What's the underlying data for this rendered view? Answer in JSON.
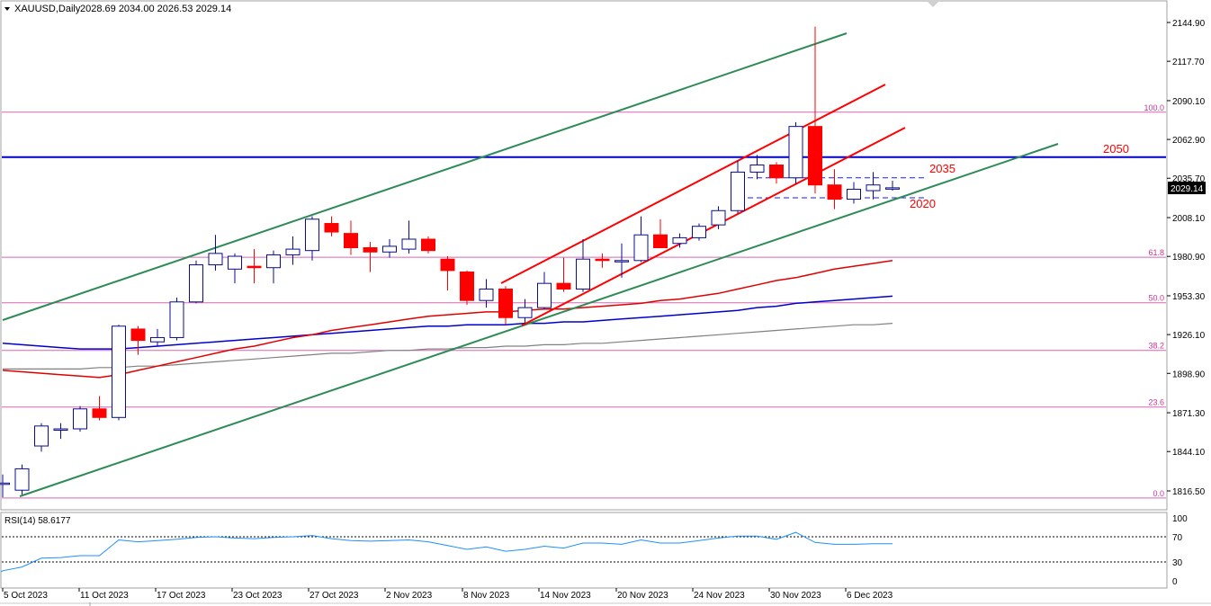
{
  "header": {
    "symbol": "XAUUSD,Daily",
    "ohlc": "2028.69 2034.00 2026.53 2029.14"
  },
  "chart_data": {
    "type": "candlestick",
    "price_axis_ticks": [
      "2144.90",
      "2117.70",
      "2090.10",
      "2062.90",
      "2035.70",
      "2008.10",
      "1980.90",
      "1953.30",
      "1926.10",
      "1898.90",
      "1871.30",
      "1844.10",
      "1816.50"
    ],
    "current_price": "2029.14",
    "x_labels": [
      "5 Oct 2023",
      "11 Oct 2023",
      "17 Oct 2023",
      "23 Oct 2023",
      "27 Oct 2023",
      "2 Nov 2023",
      "8 Nov 2023",
      "14 Nov 2023",
      "20 Nov 2023",
      "24 Nov 2023",
      "30 Nov 2023",
      "6 Dec 2023"
    ],
    "candles": [
      {
        "o": 1822,
        "h": 1828,
        "l": 1812,
        "c": 1822
      },
      {
        "o": 1817,
        "h": 1835,
        "l": 1814,
        "c": 1832
      },
      {
        "o": 1848,
        "h": 1864,
        "l": 1844,
        "c": 1862
      },
      {
        "o": 1860,
        "h": 1864,
        "l": 1853,
        "c": 1860
      },
      {
        "o": 1860,
        "h": 1876,
        "l": 1858,
        "c": 1874
      },
      {
        "o": 1874,
        "h": 1883,
        "l": 1866,
        "c": 1868
      },
      {
        "o": 1868,
        "h": 1933,
        "l": 1866,
        "c": 1932
      },
      {
        "o": 1930,
        "h": 1932,
        "l": 1912,
        "c": 1922
      },
      {
        "o": 1921,
        "h": 1930,
        "l": 1918,
        "c": 1924
      },
      {
        "o": 1924,
        "h": 1952,
        "l": 1922,
        "c": 1949
      },
      {
        "o": 1949,
        "h": 1978,
        "l": 1948,
        "c": 1975
      },
      {
        "o": 1975,
        "h": 1996,
        "l": 1971,
        "c": 1983
      },
      {
        "o": 1972,
        "h": 1983,
        "l": 1962,
        "c": 1981
      },
      {
        "o": 1974,
        "h": 1986,
        "l": 1962,
        "c": 1973
      },
      {
        "o": 1973,
        "h": 1985,
        "l": 1962,
        "c": 1982
      },
      {
        "o": 1982,
        "h": 1995,
        "l": 1975,
        "c": 1986
      },
      {
        "o": 1985,
        "h": 2009,
        "l": 1978,
        "c": 2007
      },
      {
        "o": 2004,
        "h": 2009,
        "l": 1995,
        "c": 1998
      },
      {
        "o": 1997,
        "h": 2006,
        "l": 1982,
        "c": 1987
      },
      {
        "o": 1987,
        "h": 1991,
        "l": 1970,
        "c": 1984
      },
      {
        "o": 1984,
        "h": 1993,
        "l": 1980,
        "c": 1988
      },
      {
        "o": 1986,
        "h": 2006,
        "l": 1983,
        "c": 1993
      },
      {
        "o": 1993,
        "h": 1995,
        "l": 1983,
        "c": 1985
      },
      {
        "o": 1979,
        "h": 1981,
        "l": 1957,
        "c": 1971
      },
      {
        "o": 1970,
        "h": 1971,
        "l": 1947,
        "c": 1950
      },
      {
        "o": 1950,
        "h": 1965,
        "l": 1945,
        "c": 1958
      },
      {
        "o": 1958,
        "h": 1960,
        "l": 1933,
        "c": 1938
      },
      {
        "o": 1938,
        "h": 1951,
        "l": 1934,
        "c": 1945
      },
      {
        "o": 1945,
        "h": 1970,
        "l": 1944,
        "c": 1962
      },
      {
        "o": 1962,
        "h": 1980,
        "l": 1956,
        "c": 1958
      },
      {
        "o": 1958,
        "h": 1993,
        "l": 1956,
        "c": 1979
      },
      {
        "o": 1979,
        "h": 1983,
        "l": 1973,
        "c": 1978
      },
      {
        "o": 1978,
        "h": 1990,
        "l": 1966,
        "c": 1978
      },
      {
        "o": 1978,
        "h": 2009,
        "l": 1977,
        "c": 1996
      },
      {
        "o": 1996,
        "h": 2007,
        "l": 1989,
        "c": 1987
      },
      {
        "o": 1990,
        "h": 1997,
        "l": 1987,
        "c": 1994
      },
      {
        "o": 1994,
        "h": 2004,
        "l": 1992,
        "c": 2002
      },
      {
        "o": 2003,
        "h": 2016,
        "l": 2000,
        "c": 2013
      },
      {
        "o": 2013,
        "h": 2048,
        "l": 2011,
        "c": 2040
      },
      {
        "o": 2040,
        "h": 2052,
        "l": 2035,
        "c": 2045
      },
      {
        "o": 2045,
        "h": 2047,
        "l": 2032,
        "c": 2036
      },
      {
        "o": 2036,
        "h": 2075,
        "l": 2032,
        "c": 2072
      },
      {
        "o": 2072,
        "h": 2142,
        "l": 2025,
        "c": 2031
      },
      {
        "o": 2031,
        "h": 2042,
        "l": 2014,
        "c": 2021
      },
      {
        "o": 2021,
        "h": 2033,
        "l": 2018,
        "c": 2028
      },
      {
        "o": 2027,
        "h": 2040,
        "l": 2021,
        "c": 2031
      },
      {
        "o": 2029,
        "h": 2034,
        "l": 2027,
        "c": 2029
      }
    ],
    "ma_red": [
      1901,
      1900,
      1899,
      1898,
      1897,
      1896,
      1898,
      1901,
      1904,
      1907,
      1910,
      1913,
      1916,
      1918,
      1921,
      1924,
      1926,
      1929,
      1931,
      1933,
      1935,
      1937,
      1939,
      1940,
      1941,
      1942,
      1942,
      1943,
      1944,
      1944,
      1945,
      1946,
      1947,
      1948,
      1950,
      1951,
      1953,
      1955,
      1958,
      1961,
      1964,
      1966,
      1969,
      1972,
      1974,
      1976,
      1978
    ],
    "ma_blue": [
      1920,
      1919,
      1918,
      1917,
      1916,
      1916,
      1916,
      1917,
      1918,
      1919,
      1920,
      1921,
      1922,
      1923,
      1924,
      1925,
      1926,
      1927,
      1928,
      1929,
      1930,
      1931,
      1932,
      1932,
      1933,
      1933,
      1933,
      1934,
      1934,
      1935,
      1935,
      1936,
      1937,
      1938,
      1939,
      1940,
      1941,
      1942,
      1943,
      1945,
      1946,
      1948,
      1949,
      1950,
      1951,
      1952,
      1953
    ],
    "ma_gray": [
      1902,
      1902,
      1902,
      1902,
      1902,
      1903,
      1903,
      1904,
      1904,
      1905,
      1906,
      1907,
      1908,
      1909,
      1910,
      1911,
      1912,
      1913,
      1913,
      1914,
      1915,
      1915,
      1916,
      1916,
      1917,
      1917,
      1918,
      1918,
      1919,
      1919,
      1920,
      1920,
      1921,
      1922,
      1923,
      1924,
      1925,
      1926,
      1927,
      1928,
      1929,
      1930,
      1931,
      1932,
      1933,
      1933,
      1934
    ],
    "fib_levels": [
      {
        "label": "100.0",
        "price": 2082
      },
      {
        "label": "61.8",
        "price": 1980.3
      },
      {
        "label": "50.0",
        "price": 1948.4
      },
      {
        "label": "38.2",
        "price": 1915
      },
      {
        "label": "23.6",
        "price": 1875.3
      },
      {
        "label": "0.0",
        "price": 1811.5
      }
    ],
    "horizontal_lines": [
      {
        "label": "2050",
        "price": 2050.5,
        "color": "#0000cc"
      },
      {
        "label": "2035",
        "price": 2036,
        "color": "#1a1aff"
      },
      {
        "label": "2020",
        "price": 2022,
        "color": "#1a1aff"
      }
    ],
    "rsi": {
      "label": "RSI(14) 58.6177",
      "axis_ticks": [
        "100",
        "70",
        "30",
        "0"
      ],
      "levels": [
        70,
        30
      ],
      "values": [
        16,
        22,
        36,
        37,
        40,
        40,
        65,
        62,
        64,
        66,
        69,
        70,
        68,
        67,
        69,
        70,
        72,
        67,
        64,
        63,
        64,
        65,
        62,
        56,
        50,
        54,
        47,
        50,
        55,
        52,
        60,
        60,
        58,
        65,
        60,
        60,
        64,
        68,
        71,
        71,
        66,
        77,
        61,
        58,
        58,
        59,
        59
      ]
    }
  },
  "colors": {
    "bull_body": "#ffffff",
    "bull_border": "#0b0b8f",
    "bear_body": "#ff0000",
    "green_channel": "#2e8b57",
    "red_channel": "#ff0000",
    "fib": "#cc3399",
    "rsi_line": "#1e90ff"
  }
}
